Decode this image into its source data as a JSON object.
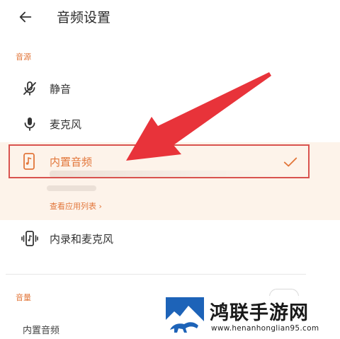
{
  "header": {
    "title": "音频设置"
  },
  "sections": {
    "source_label": "音源",
    "volume_label": "音量"
  },
  "sources": [
    {
      "label": "静音",
      "icon": "mic-off-icon"
    },
    {
      "label": "麦克风",
      "icon": "mic-icon"
    },
    {
      "label": "内置音频",
      "icon": "phone-music-icon",
      "selected": true
    },
    {
      "label": "内录和麦克风",
      "icon": "phone-mic-icon"
    }
  ],
  "selected_panel": {
    "app_list_link": "查看应用列表 ›"
  },
  "volume": {
    "item_label": "内置音频"
  },
  "watermark": {
    "name": "鸿联手游网",
    "url": "www.henanhonglian95.com"
  },
  "colors": {
    "accent": "#e2763a",
    "highlight_border": "#d9534f",
    "selected_bg": "#fdf3ea",
    "arrow": "#e8333a"
  }
}
